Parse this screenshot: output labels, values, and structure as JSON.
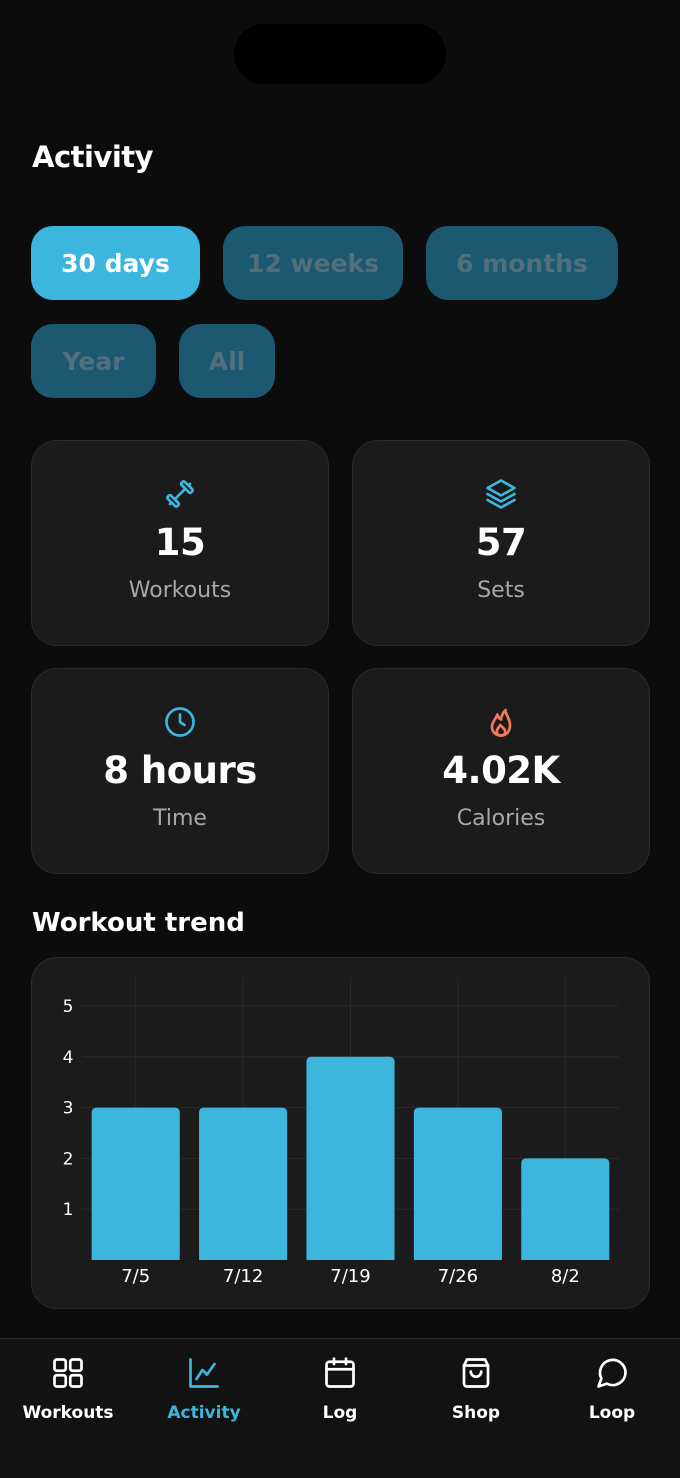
{
  "page": {
    "title": "Activity"
  },
  "filters": [
    {
      "label": "30 days",
      "active": true
    },
    {
      "label": "12 weeks",
      "active": false
    },
    {
      "label": "6 months",
      "active": false
    },
    {
      "label": "Year",
      "active": false
    },
    {
      "label": "All",
      "active": false
    }
  ],
  "stats": [
    {
      "icon": "dumbbell-icon",
      "value": "15",
      "label": "Workouts",
      "color": "#3db6de"
    },
    {
      "icon": "layers-icon",
      "value": "57",
      "label": "Sets",
      "color": "#3db6de"
    },
    {
      "icon": "clock-icon",
      "value": "8 hours",
      "label": "Time",
      "color": "#3db6de"
    },
    {
      "icon": "flame-icon",
      "value": "4.02K",
      "label": "Calories",
      "color": "#f07a5a"
    }
  ],
  "trend": {
    "title": "Workout trend"
  },
  "chart_data": {
    "type": "bar",
    "categories": [
      "7/5",
      "7/12",
      "7/19",
      "7/26",
      "8/2"
    ],
    "values": [
      3,
      3,
      4,
      3,
      2
    ],
    "yticks": [
      1,
      2,
      3,
      4,
      5
    ],
    "ylim": [
      0,
      5
    ],
    "title": "",
    "xlabel": "",
    "ylabel": "",
    "grid": true,
    "bar_color": "#3db6de"
  },
  "tabbar": {
    "items": [
      {
        "icon": "grid-icon",
        "label": "Workouts",
        "active": false
      },
      {
        "icon": "chart-icon",
        "label": "Activity",
        "active": true
      },
      {
        "icon": "calendar-icon",
        "label": "Log",
        "active": false
      },
      {
        "icon": "shopping-bag-icon",
        "label": "Shop",
        "active": false
      },
      {
        "icon": "chat-bubble-icon",
        "label": "Loop",
        "active": false
      }
    ]
  },
  "colors": {
    "accent": "#3db6de",
    "background": "#0c0c0c",
    "card": "#1b1b1b",
    "chip_inactive": "#1c5870"
  }
}
